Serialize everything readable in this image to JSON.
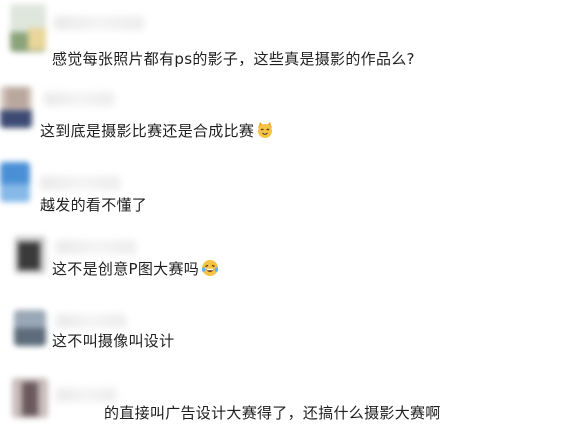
{
  "comments": [
    {
      "text": "感觉每张照片都有ps的影子，这些真是摄影的作品么?",
      "emoji": ""
    },
    {
      "text": "这到底是摄影比赛还是合成比赛",
      "emoji": "cat-face-icon"
    },
    {
      "text": "越发的看不懂了",
      "emoji": ""
    },
    {
      "text": "这不是创意P图大赛吗",
      "emoji": "laughing-tears-icon"
    },
    {
      "text": "这不叫摄像叫设计",
      "emoji": ""
    },
    {
      "text": "的直接叫广告设计大赛得了，还搞什么摄影大赛啊",
      "emoji": ""
    }
  ],
  "colors": {
    "text": "#1f1f1f",
    "emoji_yellow": "#f6c443",
    "cat_orange": "#f0a838"
  }
}
